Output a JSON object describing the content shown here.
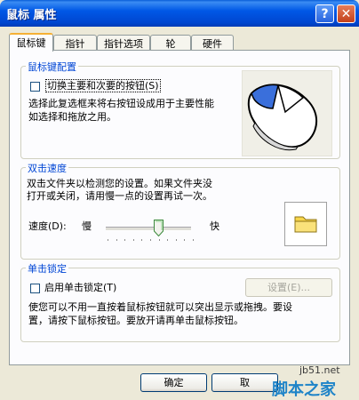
{
  "window": {
    "title": "鼠标 属性",
    "help_glyph": "?",
    "close_glyph": "✕"
  },
  "tabs": [
    {
      "label": "鼠标键",
      "active": true
    },
    {
      "label": "指针",
      "active": false
    },
    {
      "label": "指针选项",
      "active": false
    },
    {
      "label": "轮",
      "active": false
    },
    {
      "label": "硬件",
      "active": false
    }
  ],
  "button_config": {
    "legend": "鼠标键配置",
    "checkbox_label": "切换主要和次要的按钮(S)",
    "checked": false,
    "description_line1": "选择此复选框来将右按钮设成用于主要性能",
    "description_line2": "如选择和拖放之用。",
    "mouse_icon": "mouse-icon"
  },
  "double_click": {
    "legend": "双击速度",
    "description_line1": "双击文件夹以检测您的设置。如果文件夹没",
    "description_line2": "打开或关闭，请用慢一点的设置再试一次。",
    "speed_label": "速度(D):",
    "slow_label": "慢",
    "fast_label": "快",
    "speed_fraction": 0.62,
    "folder_icon": "folder-icon"
  },
  "click_lock": {
    "legend": "单击锁定",
    "checkbox_label": "启用单击锁定(T)",
    "checked": false,
    "settings_label": "设置(E)...",
    "description_line1": "使您可以不用一直按着鼠标按钮就可以突出显示或拖拽。要设",
    "description_line2": "置，请按下鼠标按钮。要放开请再单击鼠标按钮。"
  },
  "footer": {
    "ok_label": "确定",
    "cancel_partial": "取"
  },
  "watermark": {
    "line1": "jb51.net",
    "line2": "脚本之家"
  },
  "colors": {
    "title_blue": "#0058e6",
    "legend_blue": "#0046d5",
    "tab_highlight": "#f5b035"
  }
}
